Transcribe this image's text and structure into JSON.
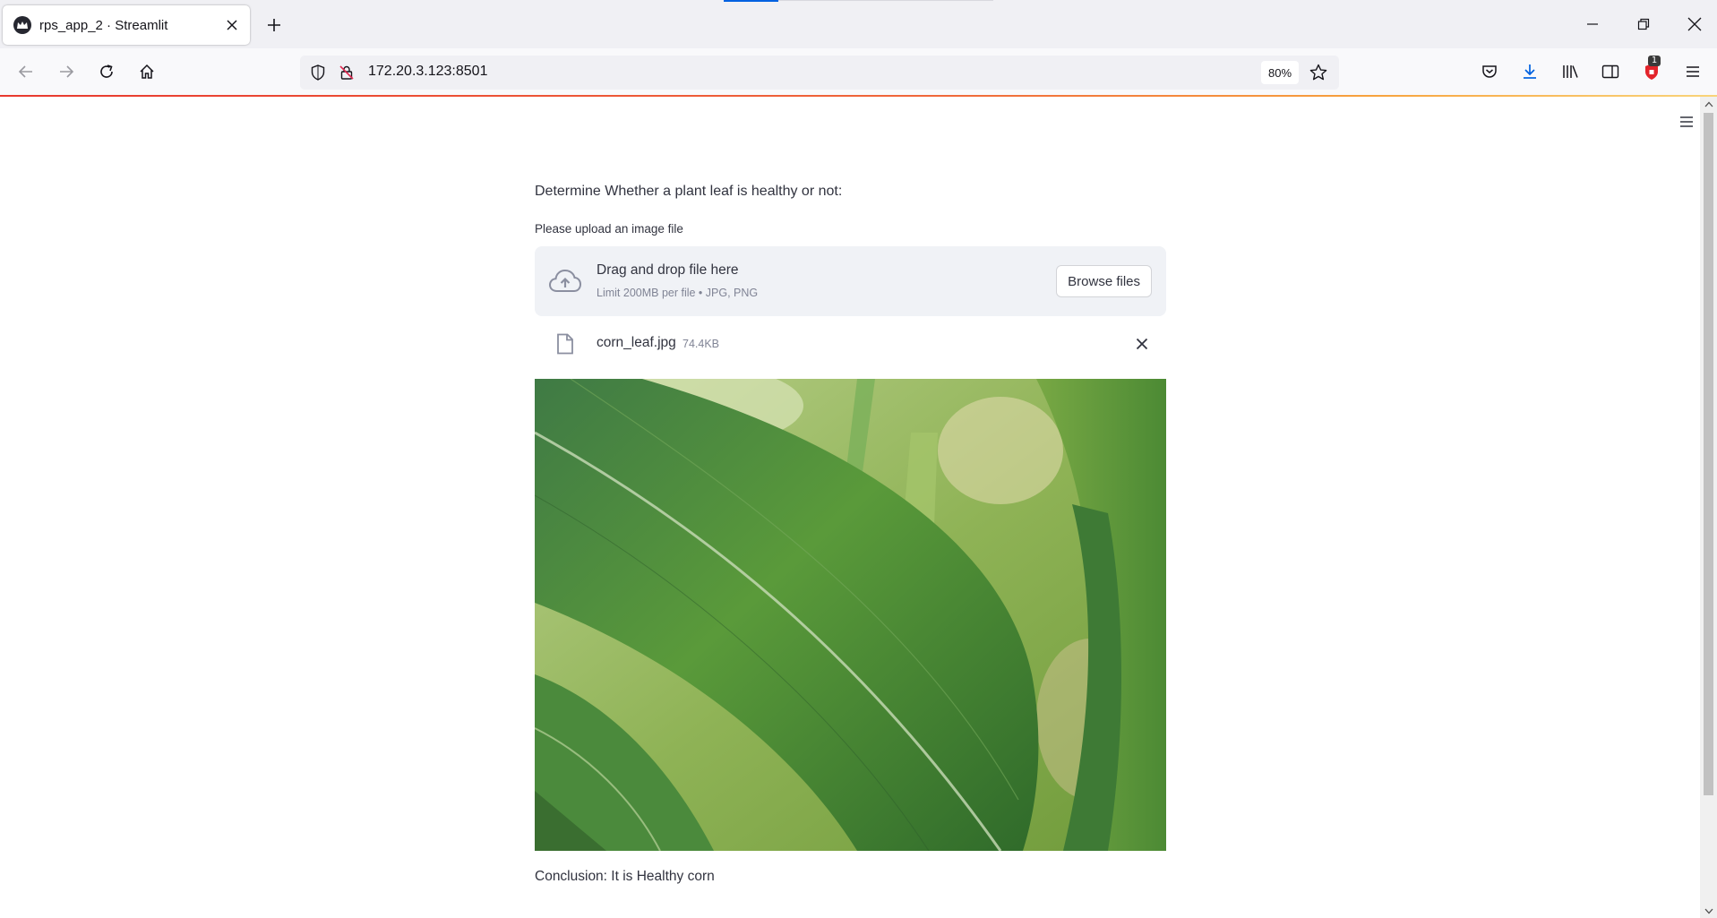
{
  "browser": {
    "tab_title": "rps_app_2 · Streamlit",
    "url": "172.20.3.123:8501",
    "zoom": "80%",
    "library_badge": "1"
  },
  "app": {
    "heading": "Determine Whether a plant leaf is healthy or not:",
    "uploader": {
      "label": "Please upload an image file",
      "drop_title": "Drag and drop file here",
      "drop_subtitle": "Limit 200MB per file • JPG, PNG",
      "browse_label": "Browse files"
    },
    "uploaded_file": {
      "name": "corn_leaf.jpg",
      "size": "74.4KB"
    },
    "conclusion": "Conclusion: It is Healthy corn"
  },
  "colors": {
    "accent_blue": "#0061e0",
    "dropzone_bg": "#f0f2f6",
    "text_primary": "#31333f",
    "text_muted": "#808495"
  }
}
